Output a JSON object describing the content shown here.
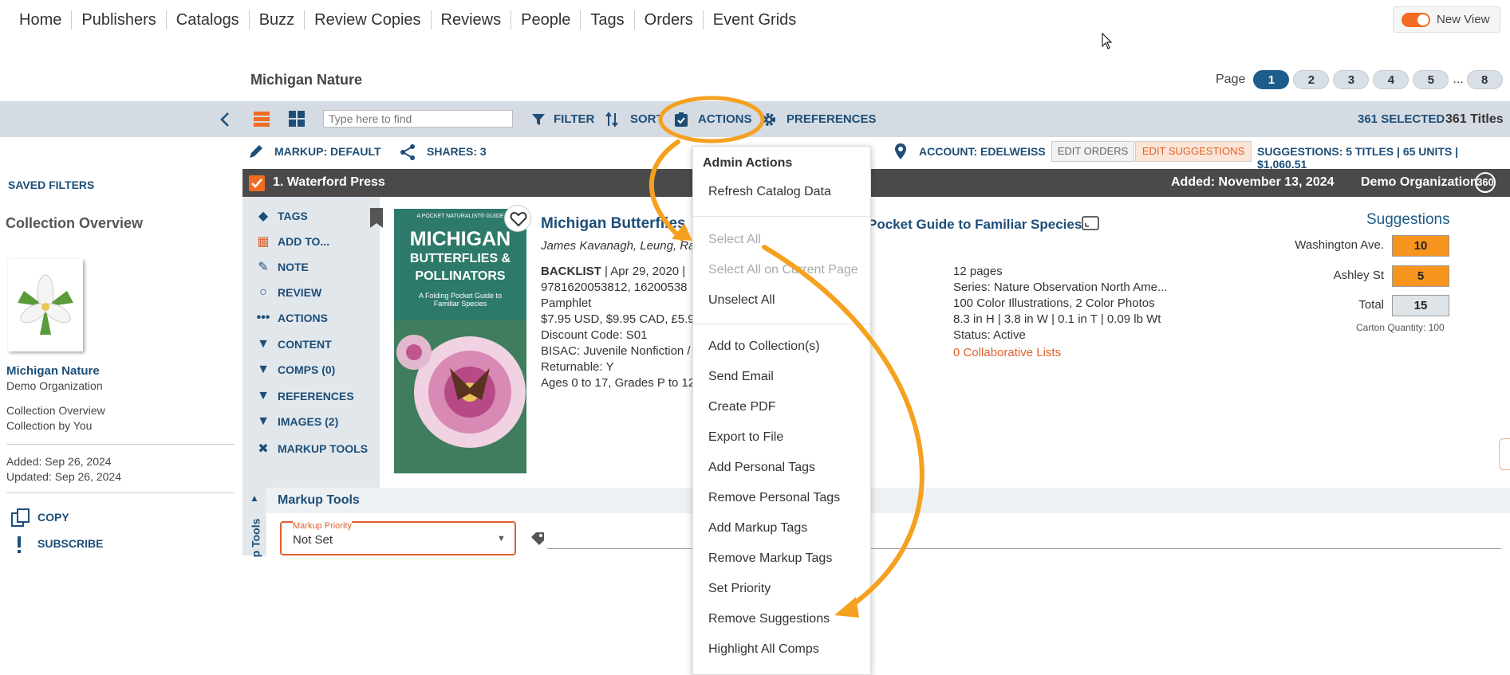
{
  "nav": {
    "items": [
      "Home",
      "Publishers",
      "Catalogs",
      "Buzz",
      "Review Copies",
      "Reviews",
      "People",
      "Tags",
      "Orders",
      "Event Grids"
    ],
    "new_view_label": "New View"
  },
  "collection": {
    "title": "Michigan Nature"
  },
  "pager": {
    "label": "Page",
    "pages": [
      "1",
      "2",
      "3",
      "4",
      "5"
    ],
    "ellipsis": "...",
    "last": "8"
  },
  "toolbar": {
    "search_placeholder": "Type here to find",
    "filter": "FILTER",
    "sort": "SORT",
    "actions": "ACTIONS",
    "preferences": "PREFERENCES",
    "selected": "361 SELECTED",
    "titles": "361 Titles"
  },
  "subbar": {
    "markup": "MARKUP: DEFAULT",
    "shares": "SHARES: 3",
    "account": "ACCOUNT: EDELWEISS",
    "edit_orders": "EDIT ORDERS",
    "edit_suggestions": "EDIT SUGGESTIONS",
    "suggestions_summary": "SUGGESTIONS: 5 TITLES | 65 UNITS | $1,060.51"
  },
  "left_panel": {
    "saved_filters": "SAVED FILTERS",
    "collection_overview": "Collection Overview",
    "collection_name": "Michigan Nature",
    "org": "Demo Organization",
    "overview": "Collection Overview",
    "by_you": "Collection by You",
    "added": "Added: Sep 26, 2024",
    "updated": "Updated: Sep 26, 2024",
    "copy": "COPY",
    "subscribe": "SUBSCRIBE"
  },
  "item_header": {
    "title": "1. Waterford Press",
    "added": "Added: November 13, 2024",
    "org": "Demo Organization",
    "badge": "360"
  },
  "side_actions": [
    "TAGS",
    "ADD TO...",
    "NOTE",
    "REVIEW",
    "ACTIONS",
    "CONTENT",
    "COMPS (0)",
    "REFERENCES",
    "IMAGES (2)",
    "MARKUP TOOLS"
  ],
  "book": {
    "cover_small": "A POCKET NATURALIST® GUIDE",
    "cover_line1": "MICHIGAN",
    "cover_line2": "BUTTERFLIES &",
    "cover_line3": "POLLINATORS",
    "cover_sub": "A Folding Pocket Guide to Familiar Species",
    "title_left": "Michigan Butterflies",
    "title_right": "Pocket Guide to Familiar Species",
    "authors": "James Kavanagh, Leung, Ra",
    "backlist": "BACKLIST",
    "date": "| Apr 29, 2020 |",
    "isbn": "9781620053812, 16200538",
    "format": "Pamphlet",
    "price": "$7.95 USD, $9.95 CAD, £5.9",
    "discount": "Discount Code: S01",
    "bisac": "BISAC: Juvenile Nonfiction /",
    "returnable": "Returnable: Y",
    "ages": "Ages 0 to 17, Grades P to 12",
    "pages": "12 pages",
    "series": "Series: Nature Observation North Ame...",
    "illustrations": "100 Color Illustrations, 2 Color Photos",
    "dimensions": "8.3 in H | 3.8 in W | 0.1 in T | 0.09 lb Wt",
    "status": "Status: Active",
    "collab": "0 Collaborative Lists"
  },
  "suggestions": {
    "heading": "Suggestions",
    "rows": [
      {
        "label": "Washington Ave.",
        "value": "10"
      },
      {
        "label": "Ashley St",
        "value": "5"
      },
      {
        "label": "Total",
        "value": "15"
      }
    ],
    "carton": "Carton Quantity: 100"
  },
  "markup_tools": {
    "title": "Markup Tools",
    "vertical_label": "p Tools",
    "priority_label": "Markup Priority",
    "priority_value": "Not Set"
  },
  "actions_menu": {
    "heading": "Admin Actions",
    "items": [
      {
        "label": "Refresh Catalog Data",
        "disabled": false
      },
      {
        "label": "Select All",
        "disabled": true
      },
      {
        "label": "Select All on Current Page",
        "disabled": true
      },
      {
        "label": "Unselect All",
        "disabled": false
      },
      {
        "label": "Add to Collection(s)",
        "disabled": false
      },
      {
        "label": "Send Email",
        "disabled": false
      },
      {
        "label": "Create PDF",
        "disabled": false
      },
      {
        "label": "Export to File",
        "disabled": false
      },
      {
        "label": "Add Personal Tags",
        "disabled": false
      },
      {
        "label": "Remove Personal Tags",
        "disabled": false
      },
      {
        "label": "Add Markup Tags",
        "disabled": false
      },
      {
        "label": "Remove Markup Tags",
        "disabled": false
      },
      {
        "label": "Set Priority",
        "disabled": false
      },
      {
        "label": "Remove Suggestions",
        "disabled": false
      },
      {
        "label": "Highlight All Comps",
        "disabled": false
      }
    ]
  },
  "colors": {
    "accent": "#f26b22",
    "nav_blue": "#1d4e78",
    "toolbar_bg": "#d4dbe2",
    "annotation_orange": "#f5a11f"
  }
}
